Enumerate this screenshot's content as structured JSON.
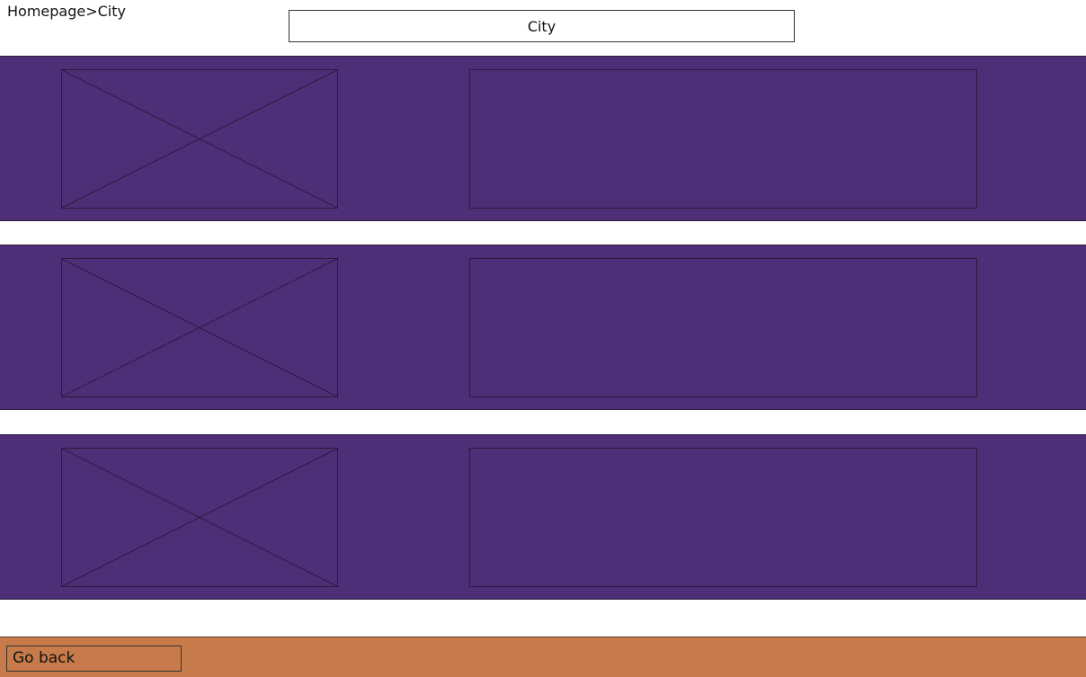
{
  "breadcrumb": {
    "home": "Homepage",
    "separator": ">",
    "current": "City"
  },
  "header": {
    "title": "City"
  },
  "colors": {
    "band": "#4d2f78",
    "footer": "#c87b4a",
    "outline": "#2a1a38"
  },
  "listings": [
    {
      "image_icon": "image-placeholder-icon"
    },
    {
      "image_icon": "image-placeholder-icon"
    },
    {
      "image_icon": "image-placeholder-icon"
    }
  ],
  "footer": {
    "back_label": "Go back"
  }
}
